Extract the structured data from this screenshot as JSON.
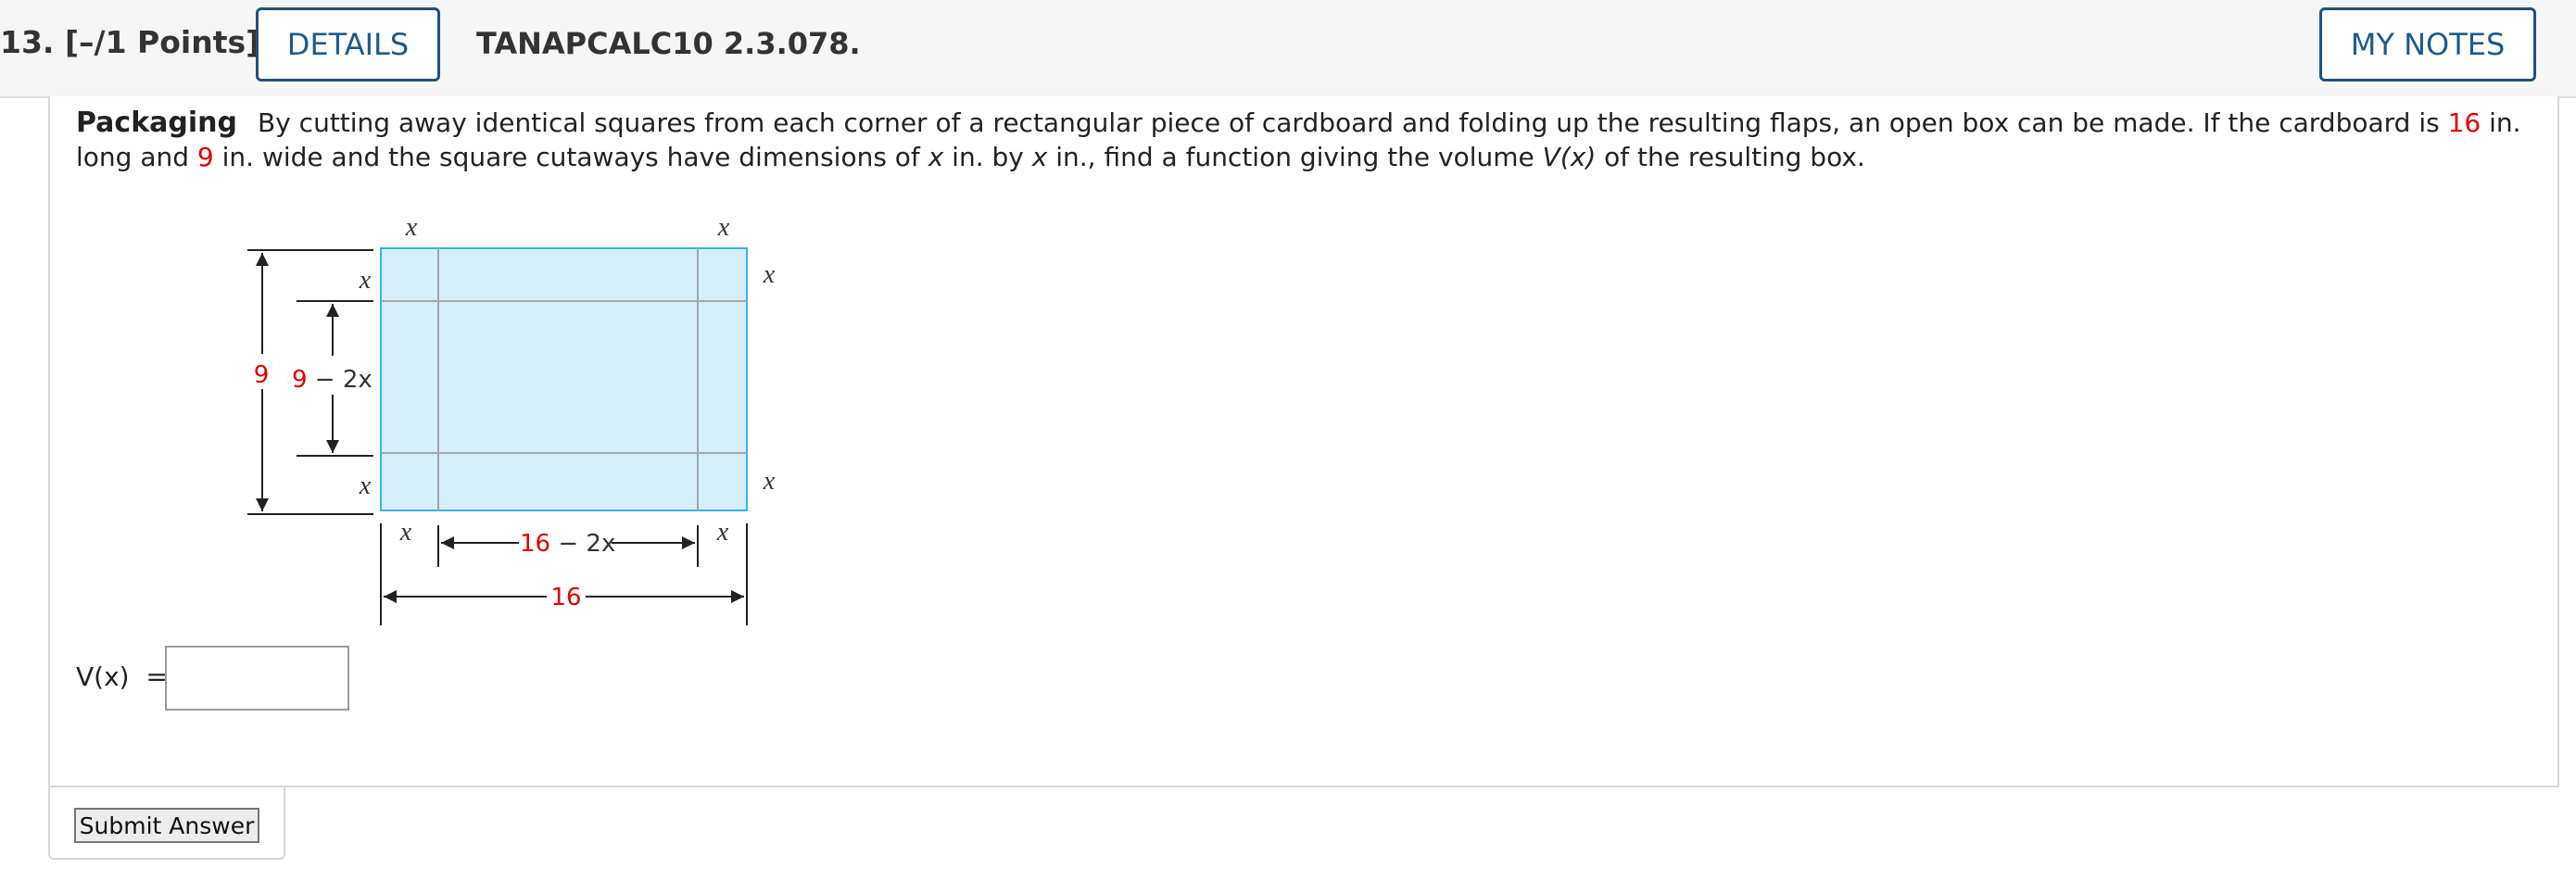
{
  "header": {
    "question_number": "13.",
    "points": "[–/1 Points]",
    "details_label": "DETAILS",
    "question_code": "TANAPCALC10 2.3.078.",
    "my_notes_label": "MY NOTES"
  },
  "question": {
    "title": "Packaging",
    "text_1": "By cutting away identical squares from each corner of a rectangular piece of cardboard and folding up the resulting flaps, an open box can be made. If the cardboard is ",
    "length_value": "16",
    "text_2": " in. long and ",
    "width_value": "9",
    "text_3": " in. wide and the square cutaways have dimensions of ",
    "var_x": "x",
    "text_4": " in. by ",
    "text_5": " in., find a function giving the volume ",
    "func_v": "V(x)",
    "text_6": " of the resulting box."
  },
  "figure": {
    "x_label": "x",
    "height_value": "9",
    "inner_height_red": "9",
    "inner_height_rest": " − 2x",
    "inner_width_red": "16",
    "inner_width_rest": " − 2x",
    "width_value": "16",
    "colors": {
      "fill": "#d4eefa",
      "outline": "#3bb0e6",
      "cut_lines": "#a6a6a6",
      "red": "#e00000"
    }
  },
  "answer": {
    "label": "V(x)  =",
    "value": "",
    "placeholder": ""
  },
  "submit": {
    "label": "Submit Answer"
  }
}
